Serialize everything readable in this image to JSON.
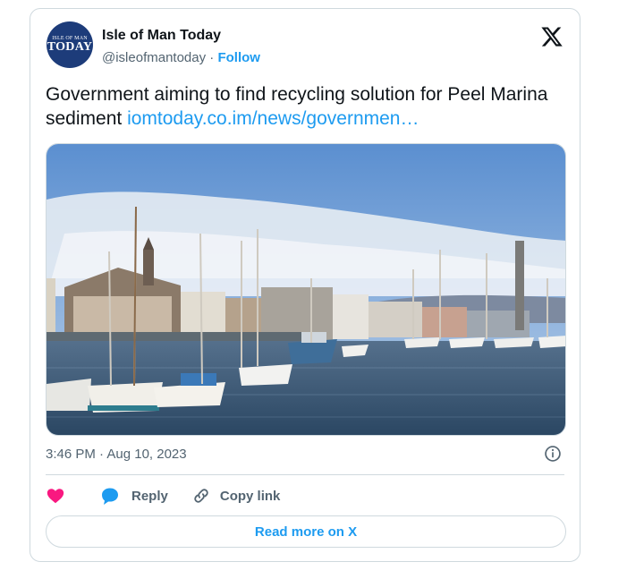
{
  "account": {
    "name": "Isle of Man Today",
    "handle": "@isleofmantoday",
    "separator": "·",
    "follow_label": "Follow",
    "avatar_line1": "ISLE OF MAN",
    "avatar_line2": "TODAY"
  },
  "tweet": {
    "text": "Government aiming to find recycling solution for Peel Marina sediment",
    "link": "iomtoday.co.im/news/governmen…",
    "timestamp": "3:46 PM · Aug 10, 2023"
  },
  "actions": {
    "reply_label": "Reply",
    "copy_label": "Copy link",
    "read_more_label": "Read more on X"
  },
  "icons": {
    "like": "heart-icon",
    "reply": "speech-bubble-icon",
    "copy": "link-icon",
    "info": "info-icon",
    "brand": "x-logo-icon"
  },
  "colors": {
    "accent": "#1d9bf0",
    "heart": "#f91880",
    "avatar_bg": "#1d3c7a",
    "border": "#cfd9de",
    "muted": "#536471"
  }
}
